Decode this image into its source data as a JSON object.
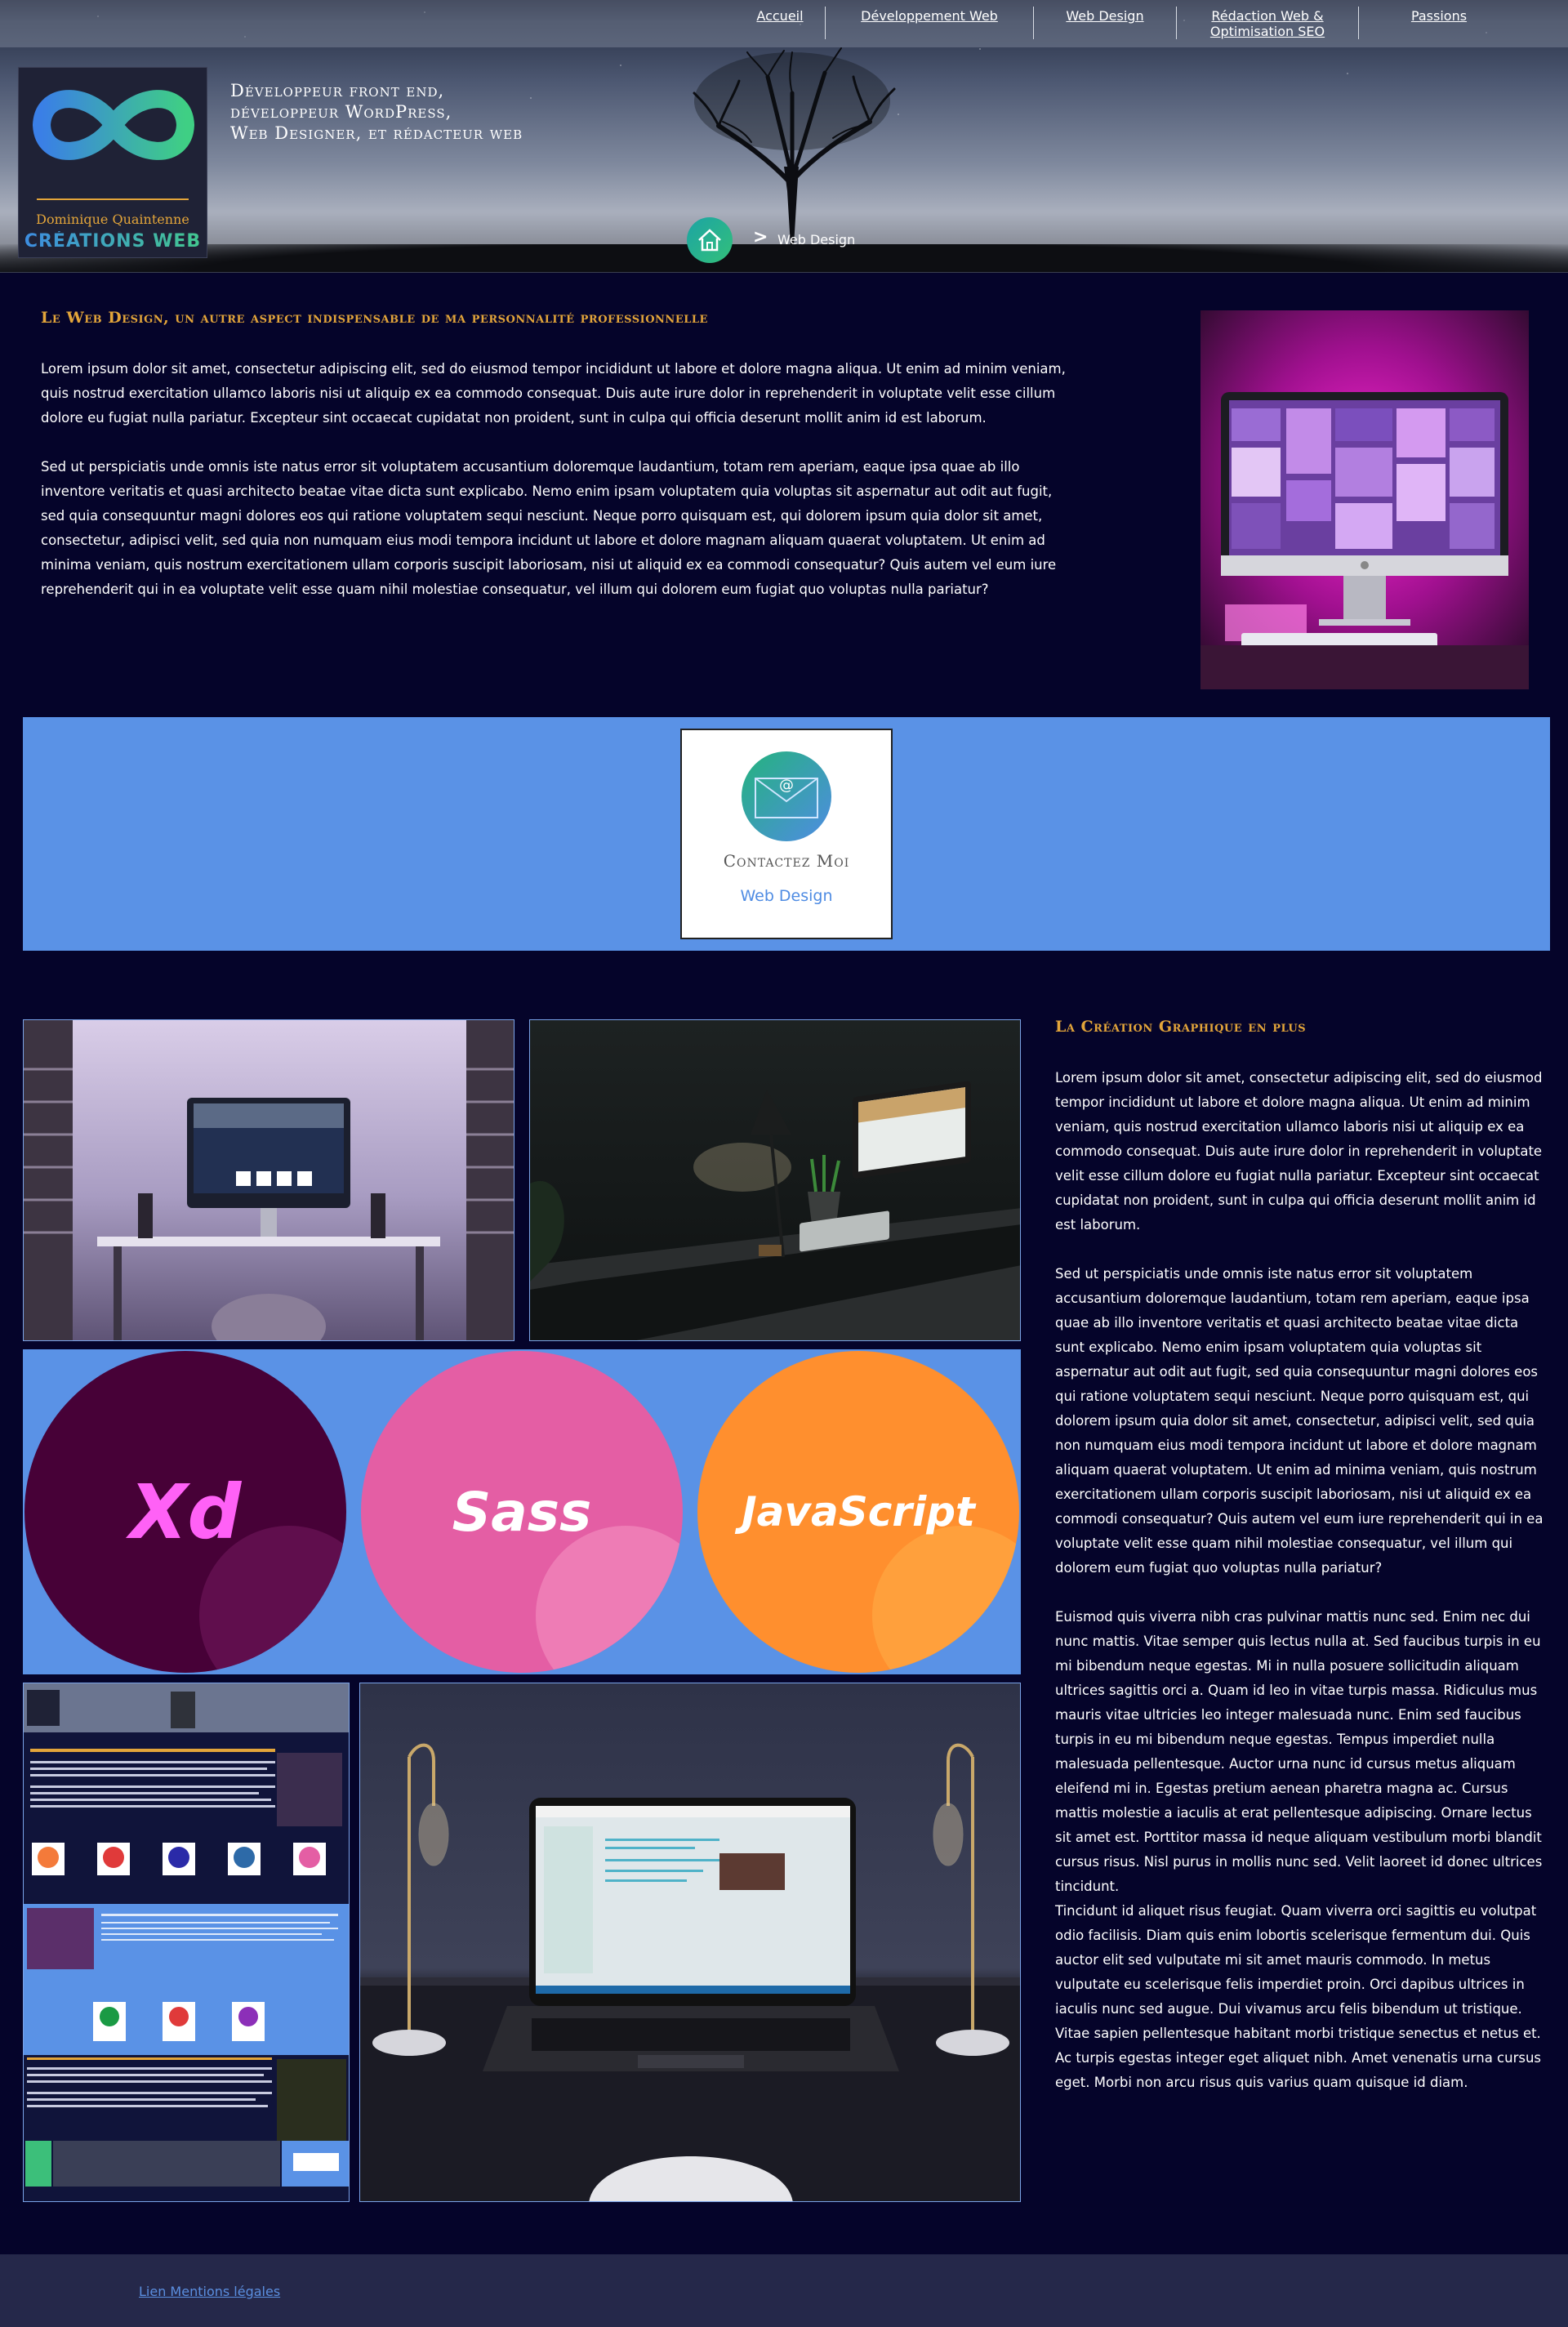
{
  "nav": {
    "items": [
      {
        "label": "Accueil"
      },
      {
        "label": "Développement Web"
      },
      {
        "label": "Web Design"
      },
      {
        "label": "Rédaction Web &\nOptimisation SEO"
      },
      {
        "label": "Passions"
      }
    ]
  },
  "logo": {
    "line1": "Dominique Quaintenne",
    "line2": "CRÉATIONS WEB"
  },
  "header": {
    "tagline": [
      "Développeur front end,",
      "développeur WordPress,",
      "Web Designer, et rédacteur web"
    ],
    "breadcrumb_separator": ">",
    "breadcrumb_current": "Web Design"
  },
  "section1": {
    "title": "Le Web Design, un autre aspect indispensable de ma personnalité professionnelle",
    "paragraphs": [
      "Lorem ipsum dolor sit amet, consectetur adipiscing elit, sed do eiusmod tempor incididunt ut labore et dolore magna aliqua. Ut enim ad minim veniam, quis nostrud exercitation ullamco laboris nisi ut aliquip ex ea commodo consequat. Duis aute irure dolor in reprehenderit in voluptate velit esse cillum dolore eu fugiat nulla pariatur. Excepteur sint occaecat cupidatat non proident, sunt in culpa qui officia deserunt mollit anim id est laborum.",
      "Sed ut perspiciatis unde omnis iste natus error sit voluptatem accusantium doloremque laudantium, totam rem aperiam, eaque ipsa quae ab illo inventore veritatis et quasi architecto beatae vitae dicta sunt explicabo. Nemo enim ipsam voluptatem quia voluptas sit aspernatur aut odit aut fugit, sed quia consequuntur magni dolores eos qui ratione voluptatem sequi nesciunt. Neque porro quisquam est, qui dolorem ipsum quia dolor sit amet, consectetur, adipisci velit, sed quia non numquam eius modi tempora incidunt ut labore et dolore magnam aliquam quaerat voluptatem. Ut enim ad minima veniam, quis nostrum exercitationem ullam corporis suscipit laboriosam, nisi ut aliquid ex ea commodi consequatur? Quis autem vel eum iure reprehenderit qui in ea voluptate velit esse quam nihil molestiae consequatur, vel illum qui dolorem eum fugiat quo voluptas nulla pariatur?"
    ]
  },
  "contact": {
    "icon_glyph": "@",
    "title": "Contactez Moi",
    "subtitle": "Web Design"
  },
  "tools": [
    {
      "label": "Xd",
      "color_bg": "#470137",
      "color_text": "#ff61f6"
    },
    {
      "label": "Sass",
      "color_bg": "#e45ea4",
      "color_text": "#ffffff"
    },
    {
      "label": "JavaScript",
      "color_bg": "#ff8f2e",
      "color_text": "#ffffff"
    }
  ],
  "section2": {
    "title": "La Création Graphique en plus",
    "paragraphs": [
      "Lorem ipsum dolor sit amet, consectetur adipiscing elit, sed do eiusmod tempor incididunt ut labore et dolore magna aliqua. Ut enim ad minim veniam, quis nostrud exercitation ullamco laboris nisi ut aliquip ex ea commodo consequat. Duis aute irure dolor in reprehenderit in voluptate velit esse cillum dolore eu fugiat nulla pariatur. Excepteur sint occaecat cupidatat non proident, sunt in culpa qui officia deserunt mollit anim id est laborum.",
      "Sed ut perspiciatis unde omnis iste natus error sit voluptatem accusantium doloremque laudantium, totam rem aperiam, eaque ipsa quae ab illo inventore veritatis et quasi architecto beatae vitae dicta sunt explicabo. Nemo enim ipsam voluptatem quia voluptas sit aspernatur aut odit aut fugit, sed quia consequuntur magni dolores eos qui ratione voluptatem sequi nesciunt. Neque porro quisquam est, qui dolorem ipsum quia dolor sit amet, consectetur, adipisci velit, sed quia non numquam eius modi tempora incidunt ut labore et dolore magnam aliquam quaerat voluptatem. Ut enim ad minima veniam, quis nostrum exercitationem ullam corporis suscipit laboriosam, nisi ut aliquid ex ea commodi consequatur? Quis autem vel eum iure reprehenderit qui in ea voluptate velit esse quam nihil molestiae consequatur, vel illum qui dolorem eum fugiat quo voluptas nulla pariatur?",
      "Euismod quis viverra nibh cras pulvinar mattis nunc sed. Enim nec dui nunc mattis. Vitae semper quis lectus nulla at. Sed faucibus turpis in eu mi bibendum neque egestas. Mi in nulla posuere sollicitudin aliquam ultrices sagittis orci a. Quam id leo in vitae turpis massa. Ridiculus mus mauris vitae ultricies leo integer malesuada nunc. Enim sed faucibus turpis in eu mi bibendum neque egestas. Tempus imperdiet nulla malesuada pellentesque. Auctor urna nunc id cursus metus aliquam eleifend mi in. Egestas pretium aenean pharetra magna ac. Cursus mattis molestie a iaculis at erat pellentesque adipiscing. Ornare lectus sit amet est. Porttitor massa id neque aliquam vestibulum morbi blandit cursus risus. Nisl purus in mollis nunc sed. Velit laoreet id donec ultrices tincidunt.",
      "Tincidunt id aliquet risus feugiat. Quam viverra orci sagittis eu volutpat odio facilisis. Diam quis enim lobortis scelerisque fermentum dui. Quis auctor elit sed vulputate mi sit amet mauris commodo. In metus vulputate eu scelerisque felis imperdiet proin. Orci dapibus ultrices in iaculis nunc sed augue. Dui vivamus arcu felis bibendum ut tristique. Vitae sapien pellentesque habitant morbi tristique senectus et netus et. Ac turpis egestas integer eget aliquet nibh. Amet venenatis urna cursus eget. Morbi non arcu risus quis varius quam quisque id diam."
    ]
  },
  "footer": {
    "link_label": "Lien Mentions légales"
  },
  "colors": {
    "background": "#05042a",
    "accent_gold": "#e3a53a",
    "band_blue": "#5a92e6",
    "link_blue": "#5b8fe0"
  }
}
